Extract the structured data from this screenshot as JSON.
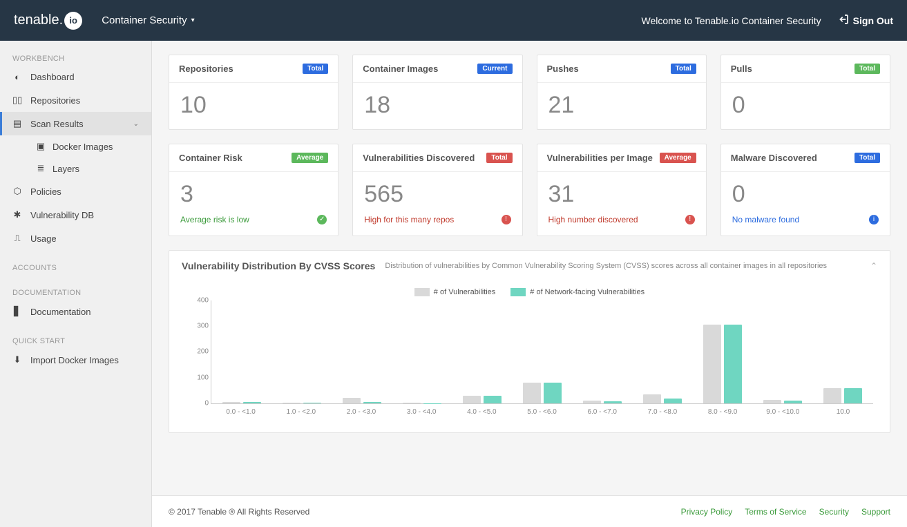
{
  "header": {
    "brand_prefix": "tenable",
    "brand_suffix": "io",
    "product": "Container Security",
    "welcome": "Welcome to Tenable.io Container Security",
    "signout": "Sign Out"
  },
  "sidebar": {
    "section_workbench": "WORKBENCH",
    "dashboard": "Dashboard",
    "repositories": "Repositories",
    "scan_results": "Scan Results",
    "docker_images": "Docker Images",
    "layers": "Layers",
    "policies": "Policies",
    "vuln_db": "Vulnerability DB",
    "usage": "Usage",
    "section_accounts": "ACCOUNTS",
    "section_documentation": "DOCUMENTATION",
    "documentation": "Documentation",
    "section_quickstart": "QUICK START",
    "import_docker": "Import Docker Images"
  },
  "cards": {
    "repositories": {
      "title": "Repositories",
      "badge": "Total",
      "value": "10"
    },
    "images": {
      "title": "Container Images",
      "badge": "Current",
      "value": "18"
    },
    "pushes": {
      "title": "Pushes",
      "badge": "Total",
      "value": "21"
    },
    "pulls": {
      "title": "Pulls",
      "badge": "Total",
      "value": "0"
    },
    "risk": {
      "title": "Container Risk",
      "badge": "Average",
      "value": "3",
      "note": "Average risk is low"
    },
    "vulns": {
      "title": "Vulnerabilities Discovered",
      "badge": "Total",
      "value": "565",
      "note": "High for this many repos"
    },
    "per_image": {
      "title": "Vulnerabilities per Image",
      "badge": "Average",
      "value": "31",
      "note": "High number discovered"
    },
    "malware": {
      "title": "Malware Discovered",
      "badge": "Total",
      "value": "0",
      "note": "No malware found"
    }
  },
  "chart_panel": {
    "title": "Vulnerability Distribution By CVSS Scores",
    "subtitle": "Distribution of vulnerabilities by Common Vulnerability Scoring System (CVSS) scores across all container images in all repositories",
    "legend_a": "# of Vulnerabilities",
    "legend_b": "# of Network-facing Vulnerabilities"
  },
  "chart_data": {
    "type": "bar",
    "categories": [
      "0.0 - <1.0",
      "1.0 - <2.0",
      "2.0 - <3.0",
      "3.0 - <4.0",
      "4.0 - <5.0",
      "5.0 - <6.0",
      "6.0 - <7.0",
      "7.0 - <8.0",
      "8.0 - <9.0",
      "9.0 - <10.0",
      "10.0"
    ],
    "series": [
      {
        "name": "# of Vulnerabilities",
        "values": [
          5,
          3,
          22,
          2,
          30,
          80,
          10,
          35,
          305,
          12,
          60
        ]
      },
      {
        "name": "# of Network-facing Vulnerabilities",
        "values": [
          4,
          2,
          5,
          1,
          28,
          80,
          8,
          18,
          305,
          10,
          60
        ]
      }
    ],
    "ylim": [
      0,
      400
    ],
    "yticks": [
      0,
      100,
      200,
      300,
      400
    ],
    "xlabel": "",
    "ylabel": ""
  },
  "footer": {
    "copyright": "© 2017 Tenable ® All Rights Reserved",
    "privacy": "Privacy Policy",
    "tos": "Terms of Service",
    "security": "Security",
    "support": "Support"
  }
}
